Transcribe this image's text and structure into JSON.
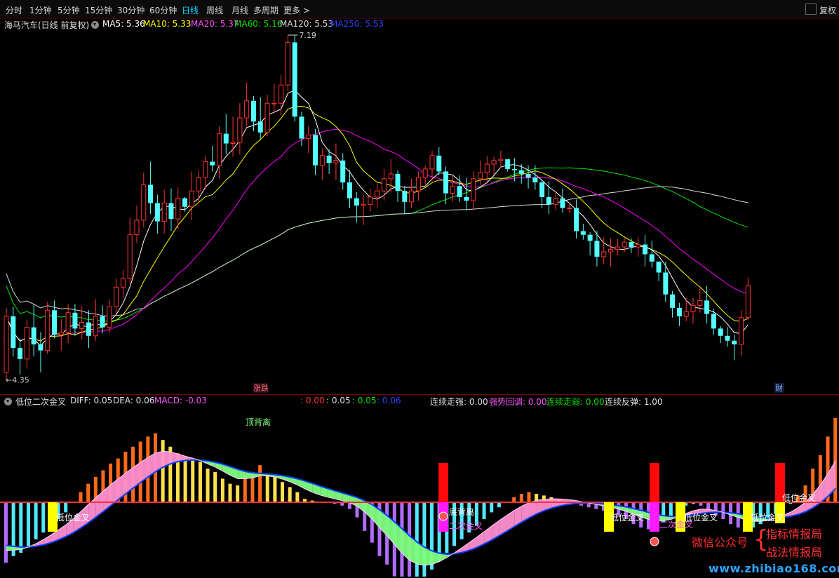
{
  "tabs": [
    {
      "label": "分时",
      "active": false
    },
    {
      "label": "1分钟",
      "active": false
    },
    {
      "label": "5分钟",
      "active": false
    },
    {
      "label": "15分钟",
      "active": false
    },
    {
      "label": "30分钟",
      "active": false
    },
    {
      "label": "60分钟",
      "active": false
    },
    {
      "label": "日线",
      "active": true
    },
    {
      "label": "周线",
      "active": false
    },
    {
      "label": "月线",
      "active": false
    },
    {
      "label": "多周期",
      "active": false
    },
    {
      "label": "更多 >",
      "active": false
    }
  ],
  "right_tab": "复权",
  "main_legend": {
    "title": "海马汽车(日线 前复权)",
    "ma5": "MA5: 5.36",
    "ma10": "MA10: 5.33",
    "ma20": "MA20: 5.37",
    "ma60": "MA60: 5.16",
    "ma120": "MA120: 5.53",
    "ma250": "MA250: 5.53"
  },
  "sub_legend": {
    "title": "低位二次金叉",
    "diff": "DIFF: 0.05",
    "dea": "DEA: 0.06",
    "macd": "MACD: -0.03",
    "v1": ": 0.00",
    "v2": ": 0.05",
    "v3": ": 0.05",
    "v4": ": 0.06",
    "strong": "连续走强: 0.00",
    "pullback": "强势回调: 0.00",
    "weak": "连续走弱: 0.00",
    "rebound": "连续反弹: 1.00"
  },
  "annotations": {
    "high_label": "7.19",
    "low_label": "4.35",
    "limit_tag": "涨跌",
    "fin_tag": "财",
    "top_div": "顶背离",
    "bottom_div": "底背离",
    "low_cross": "低位金叉",
    "second_cross": "二次金叉"
  },
  "watermark": {
    "line1": "微信公众号",
    "line2a": "指标情报局",
    "line2b": "战法情报局",
    "url": "www.zhibiao168.com"
  },
  "colors": {
    "up": "#ff3232",
    "down": "#54ffff",
    "ma5": "#ffffff",
    "ma10": "#ffff00",
    "ma20": "#ff00ff",
    "ma60": "#00e600",
    "ma250": "#0000ff",
    "diff": "#ff80ff",
    "dea": "#0040ff"
  },
  "chart_data": [
    {
      "type": "candlestick",
      "title": "海马汽车(日线 前复权)",
      "ylim": [
        4.35,
        7.19
      ],
      "high": 7.19,
      "low": 4.35,
      "ohlc": [
        [
          4.42,
          4.88,
          4.36,
          4.95
        ],
        [
          4.88,
          4.62,
          4.55,
          4.96
        ],
        [
          4.62,
          4.53,
          4.4,
          4.7
        ],
        [
          4.53,
          4.79,
          4.45,
          4.85
        ],
        [
          4.79,
          4.65,
          4.55,
          4.98
        ],
        [
          4.65,
          4.6,
          4.42,
          4.75
        ],
        [
          4.6,
          4.93,
          4.57,
          5.0
        ],
        [
          4.93,
          4.73,
          4.7,
          5.01
        ],
        [
          4.73,
          4.75,
          4.6,
          4.86
        ],
        [
          4.75,
          4.91,
          4.66,
          4.98
        ],
        [
          4.91,
          4.78,
          4.72,
          4.98
        ],
        [
          4.78,
          4.83,
          4.69,
          4.96
        ],
        [
          4.83,
          4.72,
          4.62,
          4.93
        ],
        [
          4.72,
          4.88,
          4.68,
          5.02
        ],
        [
          4.88,
          4.79,
          4.74,
          4.97
        ],
        [
          4.79,
          4.96,
          4.74,
          5.02
        ],
        [
          4.96,
          5.12,
          4.9,
          5.19
        ],
        [
          5.12,
          5.19,
          5.03,
          5.26
        ],
        [
          5.19,
          5.55,
          5.15,
          5.69
        ],
        [
          5.55,
          5.67,
          5.48,
          5.79
        ],
        [
          5.67,
          5.96,
          5.61,
          6.06
        ],
        [
          5.96,
          5.81,
          5.72,
          6.15
        ],
        [
          5.81,
          5.66,
          5.56,
          5.88
        ],
        [
          5.66,
          5.81,
          5.56,
          5.92
        ],
        [
          5.81,
          5.68,
          5.58,
          5.93
        ],
        [
          5.68,
          5.85,
          5.6,
          5.94
        ],
        [
          5.85,
          5.78,
          5.74,
          5.86
        ],
        [
          5.78,
          5.91,
          5.67,
          6.07
        ],
        [
          5.91,
          6.02,
          5.81,
          6.08
        ],
        [
          6.02,
          6.15,
          5.92,
          6.2
        ],
        [
          6.15,
          6.12,
          6.07,
          6.28
        ],
        [
          6.12,
          6.38,
          6.01,
          6.44
        ],
        [
          6.38,
          6.3,
          6.21,
          6.54
        ],
        [
          6.3,
          6.31,
          6.19,
          6.52
        ],
        [
          6.31,
          6.51,
          6.21,
          6.63
        ],
        [
          6.51,
          6.65,
          6.44,
          6.8
        ],
        [
          6.65,
          6.48,
          6.4,
          6.69
        ],
        [
          6.48,
          6.39,
          6.33,
          6.68
        ],
        [
          6.39,
          6.63,
          6.36,
          6.7
        ],
        [
          6.63,
          6.63,
          6.55,
          6.79
        ],
        [
          6.63,
          6.78,
          6.53,
          6.86
        ],
        [
          6.78,
          7.13,
          6.73,
          7.19
        ],
        [
          7.13,
          6.52,
          6.48,
          7.19
        ],
        [
          6.52,
          6.34,
          6.28,
          6.56
        ],
        [
          6.34,
          6.37,
          6.22,
          6.44
        ],
        [
          6.37,
          6.12,
          6.04,
          6.42
        ],
        [
          6.12,
          6.2,
          6.0,
          6.26
        ],
        [
          6.2,
          6.14,
          6.05,
          6.25
        ],
        [
          6.14,
          6.16,
          6.0,
          6.3
        ],
        [
          6.16,
          5.98,
          5.92,
          6.22
        ],
        [
          5.98,
          5.85,
          5.77,
          6.08
        ],
        [
          5.85,
          5.79,
          5.65,
          5.9
        ],
        [
          5.79,
          5.8,
          5.63,
          5.88
        ],
        [
          5.8,
          5.86,
          5.74,
          5.93
        ],
        [
          5.86,
          5.91,
          5.77,
          5.97
        ],
        [
          5.91,
          6.01,
          5.83,
          6.09
        ],
        [
          6.01,
          6.05,
          5.9,
          6.17
        ],
        [
          6.05,
          5.91,
          5.82,
          6.08
        ],
        [
          5.91,
          5.82,
          5.72,
          5.95
        ],
        [
          5.82,
          5.91,
          5.77,
          6.01
        ],
        [
          5.91,
          6.02,
          5.83,
          6.07
        ],
        [
          6.02,
          6.09,
          5.96,
          6.12
        ],
        [
          6.09,
          6.2,
          6.0,
          6.24
        ],
        [
          6.2,
          6.07,
          6.04,
          6.27
        ],
        [
          6.07,
          5.89,
          5.8,
          6.11
        ],
        [
          5.89,
          5.95,
          5.82,
          6.04
        ],
        [
          5.95,
          5.86,
          5.82,
          6.04
        ],
        [
          5.86,
          5.83,
          5.75,
          6.02
        ],
        [
          5.83,
          6.01,
          5.75,
          6.07
        ],
        [
          6.01,
          6.06,
          5.96,
          6.16
        ],
        [
          6.06,
          6.13,
          5.98,
          6.2
        ],
        [
          6.13,
          6.16,
          6.04,
          6.19
        ],
        [
          6.16,
          6.17,
          6.1,
          6.24
        ],
        [
          6.17,
          6.09,
          6.07,
          6.17
        ],
        [
          6.09,
          6.08,
          5.99,
          6.18
        ],
        [
          6.08,
          6.05,
          5.97,
          6.13
        ],
        [
          6.05,
          6.02,
          5.93,
          6.12
        ],
        [
          6.02,
          5.98,
          5.92,
          6.12
        ],
        [
          5.98,
          5.86,
          5.77,
          6.0
        ],
        [
          5.86,
          5.8,
          5.72,
          5.99
        ],
        [
          5.8,
          5.85,
          5.75,
          5.91
        ],
        [
          5.85,
          5.77,
          5.73,
          5.93
        ],
        [
          5.77,
          5.77,
          5.73,
          5.81
        ],
        [
          5.77,
          5.58,
          5.52,
          5.84
        ],
        [
          5.58,
          5.55,
          5.51,
          5.64
        ],
        [
          5.55,
          5.5,
          5.38,
          5.57
        ],
        [
          5.5,
          5.37,
          5.29,
          5.58
        ],
        [
          5.37,
          5.41,
          5.31,
          5.53
        ],
        [
          5.41,
          5.43,
          5.29,
          5.52
        ],
        [
          5.43,
          5.45,
          5.38,
          5.52
        ],
        [
          5.45,
          5.49,
          5.41,
          5.53
        ],
        [
          5.49,
          5.45,
          5.4,
          5.52
        ],
        [
          5.45,
          5.47,
          5.37,
          5.53
        ],
        [
          5.47,
          5.39,
          5.29,
          5.55
        ],
        [
          5.39,
          5.33,
          5.28,
          5.5
        ],
        [
          5.33,
          5.24,
          5.17,
          5.3
        ],
        [
          5.24,
          5.06,
          5.0,
          5.33
        ],
        [
          5.06,
          4.95,
          4.87,
          5.09
        ],
        [
          4.95,
          4.88,
          4.8,
          4.99
        ],
        [
          4.88,
          4.92,
          4.84,
          5.03
        ],
        [
          4.92,
          4.97,
          4.82,
          5.03
        ],
        [
          4.97,
          5.01,
          4.91,
          5.12
        ],
        [
          5.01,
          4.9,
          4.82,
          5.13
        ],
        [
          4.9,
          4.78,
          4.73,
          4.94
        ],
        [
          4.78,
          4.72,
          4.66,
          4.8
        ],
        [
          4.72,
          4.68,
          4.63,
          4.79
        ],
        [
          4.68,
          4.65,
          4.52,
          4.73
        ],
        [
          4.65,
          4.87,
          4.56,
          4.93
        ],
        [
          4.87,
          5.13,
          4.85,
          5.2
        ]
      ]
    },
    {
      "type": "bar",
      "title": "低位二次金叉",
      "series": [
        {
          "name": "DIFF",
          "value": 0.05
        },
        {
          "name": "DEA",
          "value": 0.06
        },
        {
          "name": "MACD",
          "value": -0.03
        }
      ],
      "macd": [
        -0.36,
        -0.32,
        -0.3,
        -0.26,
        -0.22,
        -0.18,
        -0.14,
        -0.1,
        -0.06,
        0.0,
        0.06,
        0.11,
        0.15,
        0.19,
        0.23,
        0.26,
        0.3,
        0.33,
        0.36,
        0.39,
        0.41,
        0.37,
        0.33,
        0.29,
        0.27,
        0.26,
        0.24,
        0.2,
        0.18,
        0.14,
        0.11,
        0.1,
        0.16,
        0.18,
        0.22,
        0.17,
        0.15,
        0.12,
        0.09,
        0.06,
        0.02,
        0.01,
        0.0,
        0.0,
        -0.01,
        -0.02,
        -0.04,
        -0.09,
        -0.17,
        -0.24,
        -0.32,
        -0.37,
        -0.44,
        -0.5,
        -0.51,
        -0.48,
        -0.45,
        -0.4,
        -0.35,
        -0.3,
        -0.26,
        -0.22,
        -0.18,
        -0.14,
        -0.1,
        -0.06,
        -0.03,
        0.0,
        0.03,
        0.05,
        0.06,
        0.05,
        0.04,
        0.03,
        0.02,
        0.01,
        0.0,
        -0.02,
        -0.03,
        -0.04,
        -0.05,
        -0.06,
        -0.08,
        -0.1,
        -0.13,
        -0.15,
        -0.16,
        -0.15,
        -0.12,
        -0.09,
        -0.05,
        -0.02,
        -0.01,
        -0.02,
        -0.05,
        -0.08,
        -0.1,
        -0.13,
        -0.15,
        -0.16,
        -0.15,
        -0.13,
        -0.1,
        -0.07,
        -0.04,
        -0.01,
        0.04,
        0.1,
        0.2,
        0.28,
        0.39,
        0.5
      ]
    }
  ]
}
